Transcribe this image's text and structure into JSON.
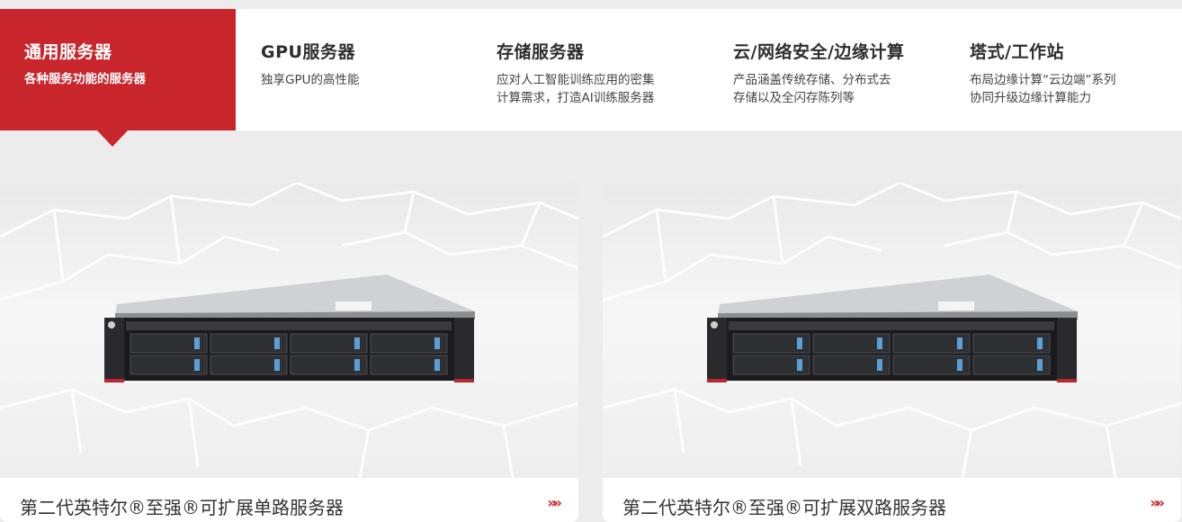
{
  "tabs": [
    {
      "title": "通用服务器",
      "desc": "各种服务功能的服务器",
      "active": true
    },
    {
      "title": "GPU服务器",
      "desc": "独享GPU的高性能"
    },
    {
      "title": "存储服务器",
      "desc_line1": "应对人工智能训练应用的密集",
      "desc_line2": "计算需求，打造AI训练服务器"
    },
    {
      "title": "云/网络安全/边缘计算",
      "desc_line1": "产品涵盖传统存储、分布式去",
      "desc_line2": "存储以及全闪存陈列等"
    },
    {
      "title": "塔式/工作站",
      "desc_line1": "布局边缘计算“云边端”系列",
      "desc_line2": "协同升级边缘计算能力"
    }
  ],
  "cards": [
    {
      "caption": "第二代英特尔®至强®可扩展单路服务器",
      "arrow": "»»"
    },
    {
      "caption": "第二代英特尔®至强®可扩展双路服务器",
      "arrow": "»»"
    }
  ],
  "colors": {
    "accent": "#c8252c",
    "background": "#ececec"
  },
  "icons": {
    "more": "triple-chevron-right-icon"
  }
}
